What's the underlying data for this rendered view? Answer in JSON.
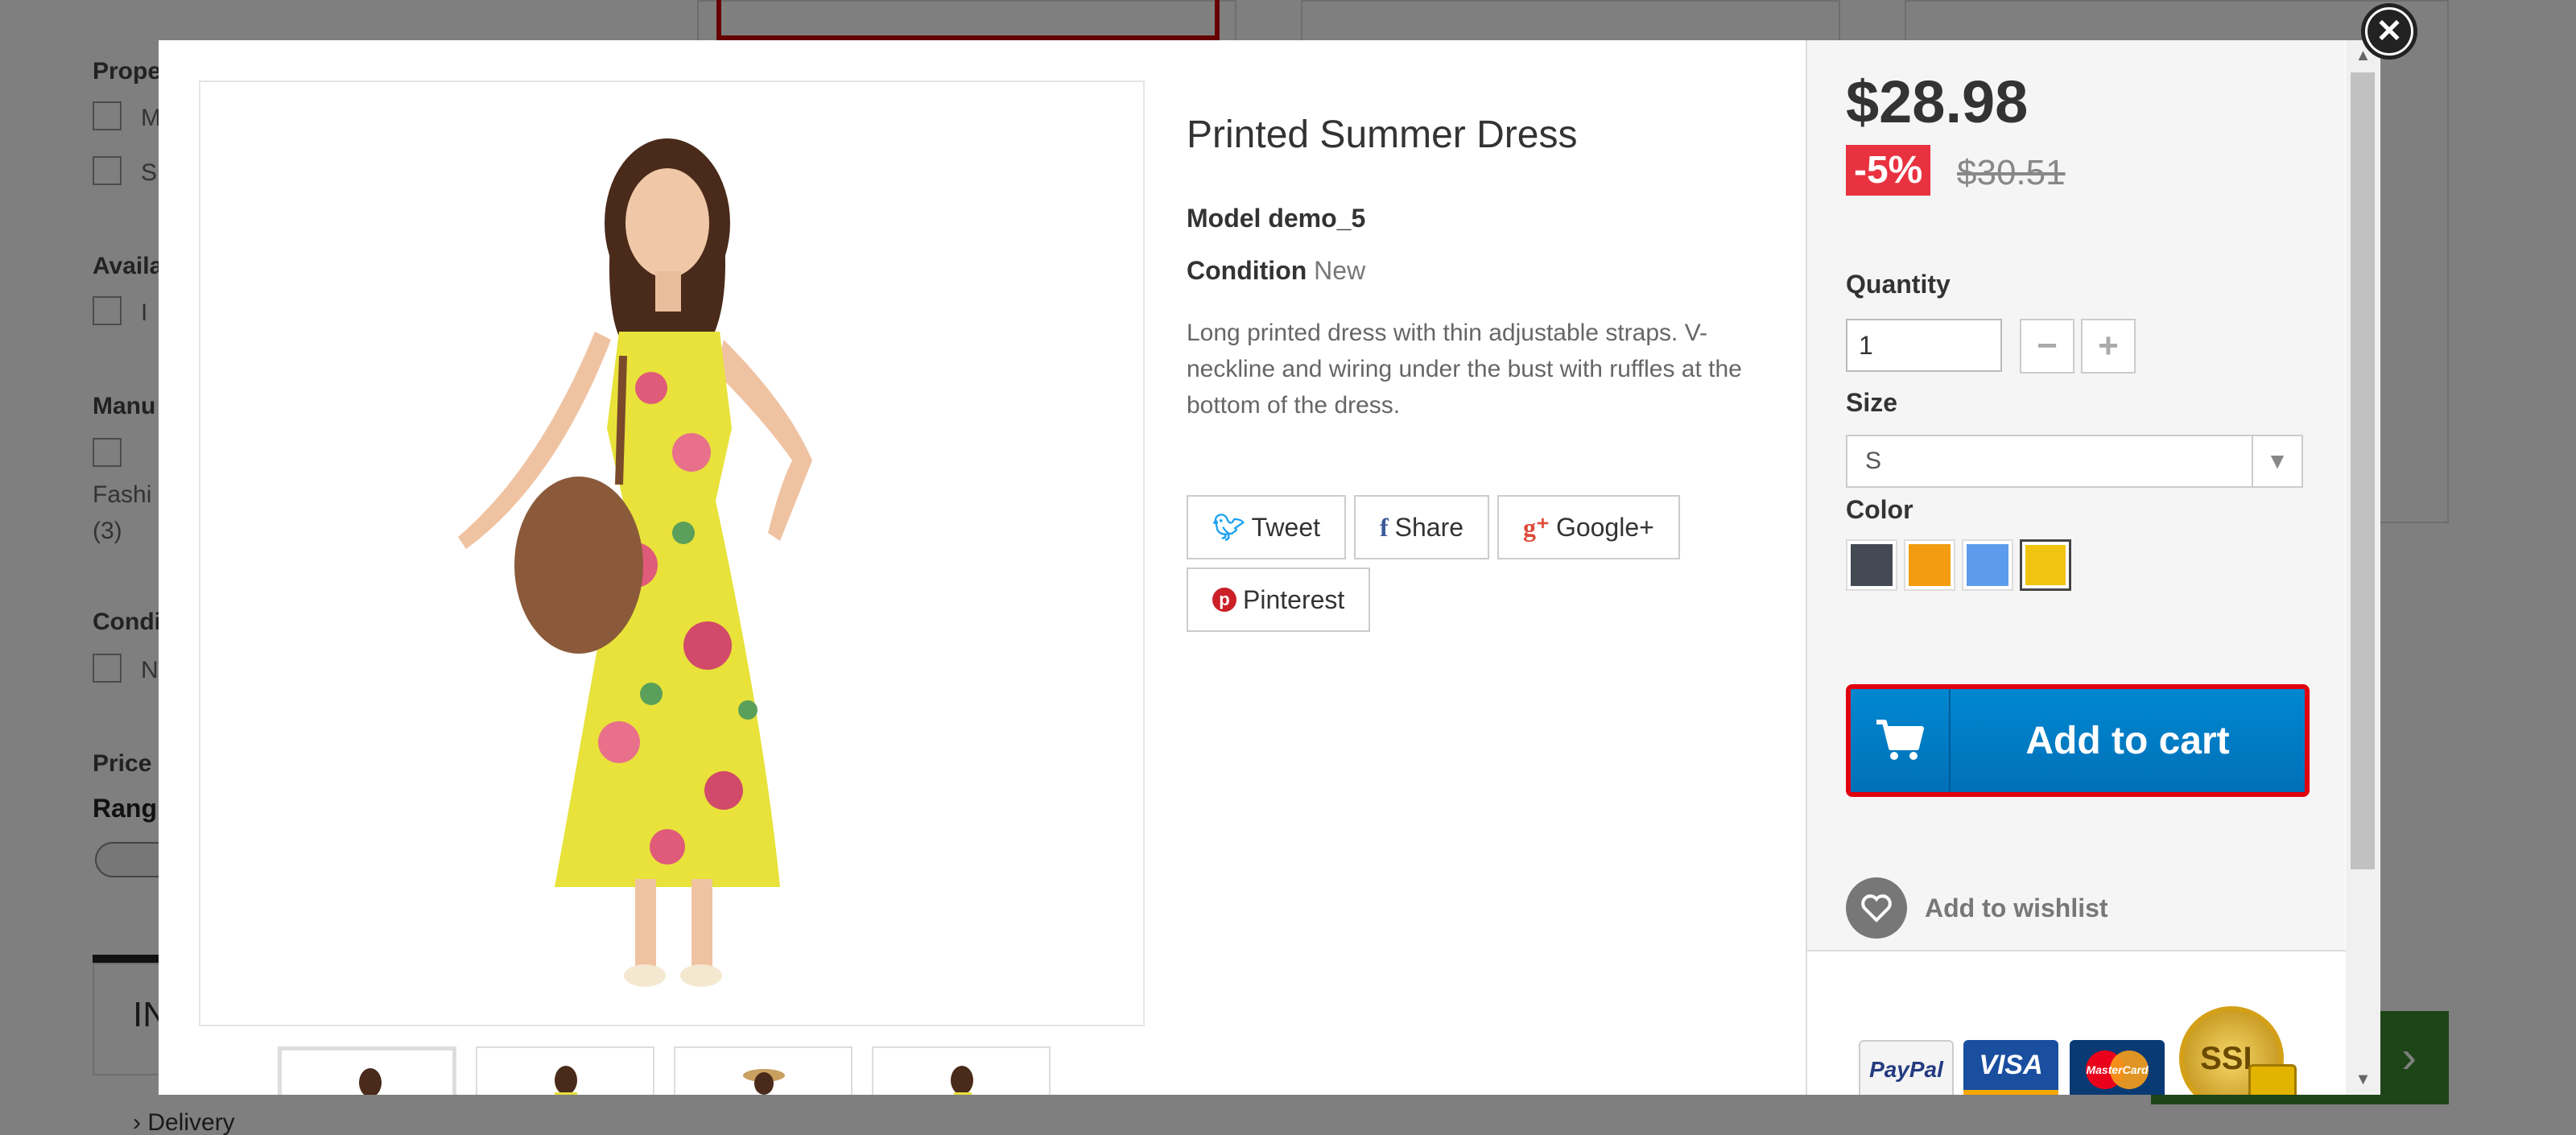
{
  "background": {
    "filters": {
      "properties_title": "Prope",
      "availability_title": "Availa",
      "manufacturer_title": "Manu",
      "manufacturer_item": "Fashi",
      "manufacturer_count": "(3)",
      "condition_title": "Condi",
      "price_title": "Price",
      "price_range_label": "Rang"
    },
    "tab_title": "IN",
    "delivery_link": "Delivery"
  },
  "modal": {
    "close_icon": "close-circle-icon",
    "product": {
      "title": "Printed Summer Dress",
      "model_label": "Model",
      "model_value": "demo_5",
      "condition_label": "Condition",
      "condition_value": "New",
      "description": "Long printed dress with thin adjustable straps. V-neckline and wiring under the bust with ruffles at the bottom of the dress."
    },
    "social": [
      {
        "label": "Tweet",
        "icon": "twitter-icon"
      },
      {
        "label": "Share",
        "icon": "facebook-icon"
      },
      {
        "label": "Google+",
        "icon": "google-plus-icon"
      },
      {
        "label": "Pinterest",
        "icon": "pinterest-icon"
      }
    ],
    "purchase": {
      "price": "$28.98",
      "discount": "-5%",
      "old_price": "$30.51",
      "quantity_label": "Quantity",
      "quantity_value": "1",
      "size_label": "Size",
      "size_value": "S",
      "color_label": "Color",
      "colors": [
        "#434a54",
        "#f39c11",
        "#5d9cec",
        "#f1c40f"
      ],
      "selected_color_index": 3,
      "add_to_cart": "Add to cart",
      "wishlist": "Add to wishlist"
    },
    "payment_badges": {
      "paypal": "PayPal",
      "visa": "VISA",
      "mastercard": "MasterCard",
      "ssl": "SSL"
    }
  }
}
